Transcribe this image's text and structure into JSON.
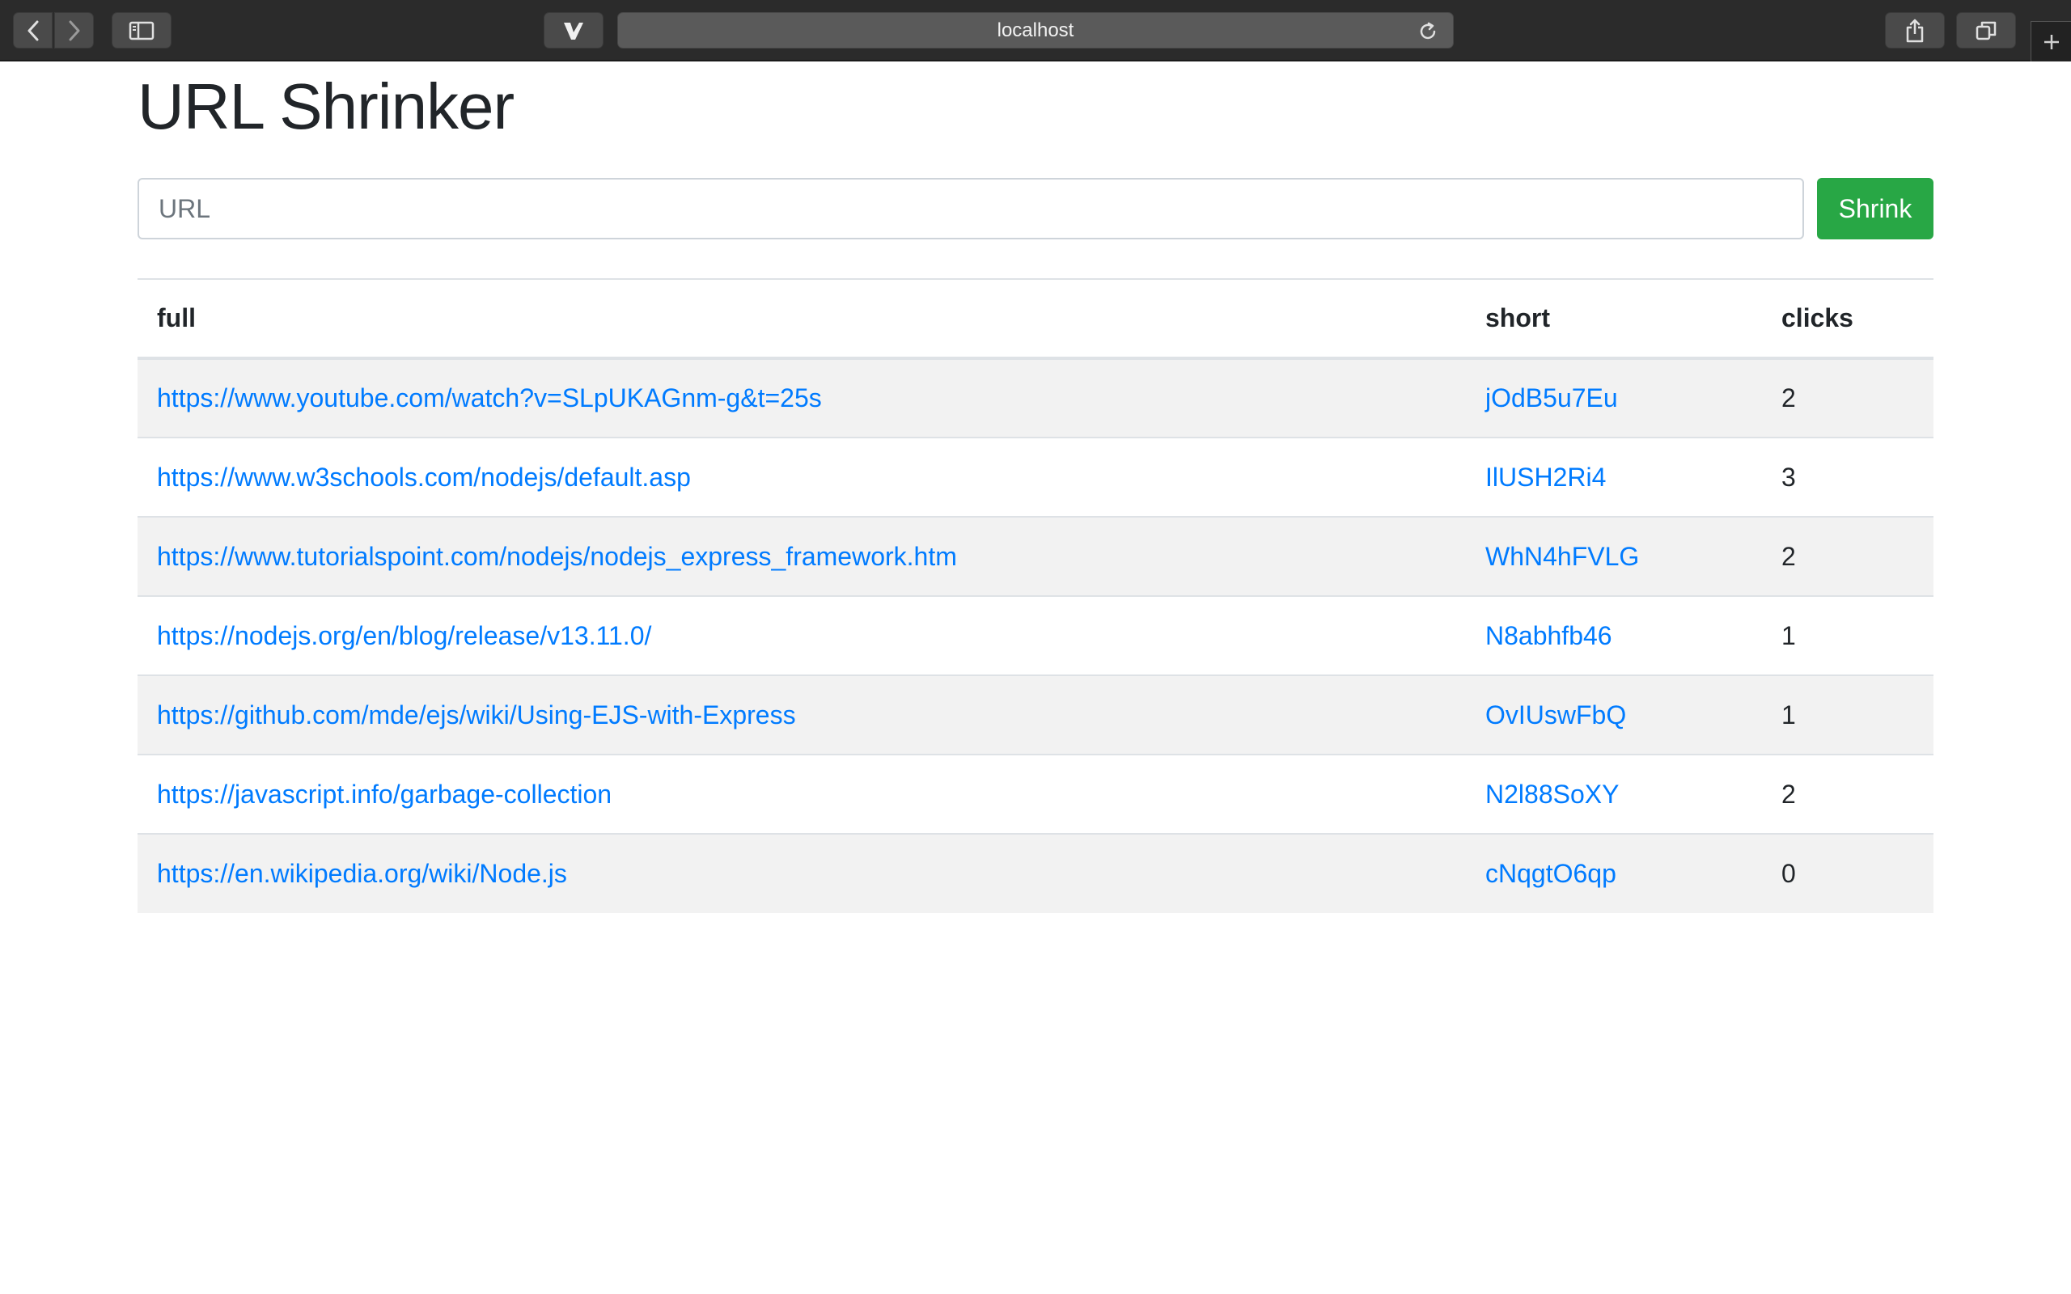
{
  "browser": {
    "address": "localhost"
  },
  "page": {
    "title": "URL Shrinker",
    "input_placeholder": "URL",
    "input_value": "",
    "shrink_label": "Shrink"
  },
  "table": {
    "headers": [
      "full",
      "short",
      "clicks"
    ],
    "rows": [
      {
        "full": "https://www.youtube.com/watch?v=SLpUKAGnm-g&t=25s",
        "short": "jOdB5u7Eu",
        "clicks": "2"
      },
      {
        "full": "https://www.w3schools.com/nodejs/default.asp",
        "short": "IlUSH2Ri4",
        "clicks": "3"
      },
      {
        "full": "https://www.tutorialspoint.com/nodejs/nodejs_express_framework.htm",
        "short": "WhN4hFVLG",
        "clicks": "2"
      },
      {
        "full": "https://nodejs.org/en/blog/release/v13.11.0/",
        "short": "N8abhfb46",
        "clicks": "1"
      },
      {
        "full": "https://github.com/mde/ejs/wiki/Using-EJS-with-Express",
        "short": "OvIUswFbQ",
        "clicks": "1"
      },
      {
        "full": "https://javascript.info/garbage-collection",
        "short": "N2l88SoXY",
        "clicks": "2"
      },
      {
        "full": "https://en.wikipedia.org/wiki/Node.js",
        "short": "cNqgtO6qp",
        "clicks": "0"
      }
    ]
  },
  "icons": {
    "back": "chevron-left-icon",
    "forward": "chevron-right-icon",
    "sidebar": "sidebar-icon",
    "vivaldi": "vivaldi-logo-icon",
    "reload": "reload-icon",
    "share": "share-icon",
    "tabs": "tabs-overview-icon",
    "new_tab": "plus-icon"
  },
  "colors": {
    "link": "#007bff",
    "shrink_button": "#28a745",
    "chrome_bg": "#2b2b2b",
    "row_stripe": "#f2f2f2"
  }
}
